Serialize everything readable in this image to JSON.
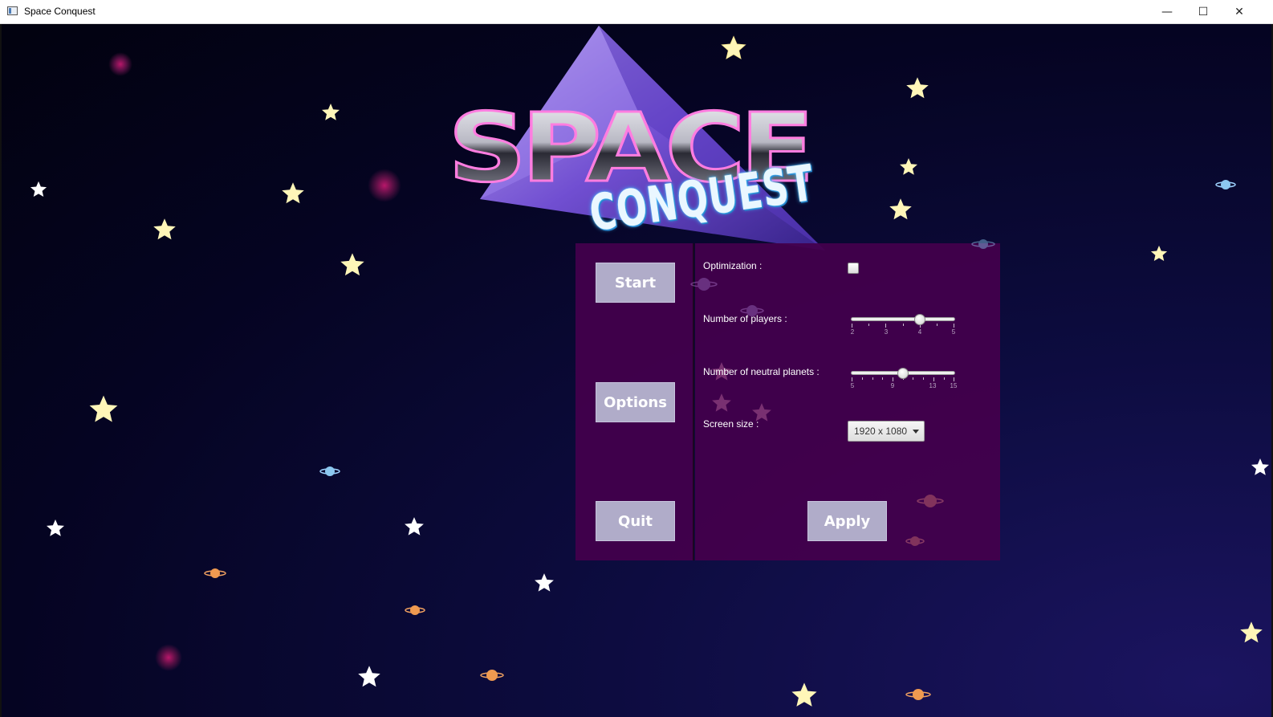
{
  "window": {
    "title": "Space Conquest",
    "minimize_glyph": "—",
    "maximize_glyph": "☐",
    "close_glyph": "✕"
  },
  "logo": {
    "line1": "SPACE",
    "line2": "CONQUEST"
  },
  "menu": {
    "start": "Start",
    "options": "Options",
    "quit": "Quit"
  },
  "options": {
    "optimization_label": "Optimization :",
    "optimization_checked": false,
    "players_label": "Number of players :",
    "players_value": 4,
    "players_min": 2,
    "players_max": 5,
    "players_ticks": [
      "2",
      "3",
      "4",
      "5"
    ],
    "neutral_label": "Number of neutral planets :",
    "neutral_value": 10,
    "neutral_min": 5,
    "neutral_max": 15,
    "neutral_ticks": [
      "5",
      "9",
      "13",
      "15"
    ],
    "screen_size_label": "Screen size :",
    "screen_size_value": "1920 x 1080",
    "apply": "Apply"
  },
  "colors": {
    "panel": "#44004c",
    "button": "#b0acc9",
    "star": "#fff6b8"
  }
}
